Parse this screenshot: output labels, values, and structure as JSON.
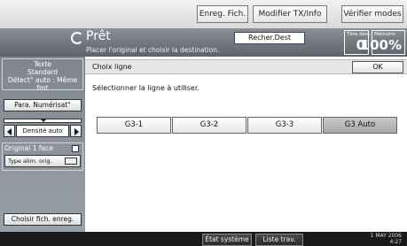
{
  "topbar": {
    "enreg_fich": "Enreg. Fich.",
    "modifier_tx": "Modifier TX/Info",
    "verifier_modes": "Vérifier modes"
  },
  "header": {
    "title": "Prêt",
    "subtitle": "Placer l'original et choisir la destination.",
    "search_button": "Recher.Dest",
    "counter_dest_label": "Titre dest.",
    "counter_dest_value": "0",
    "counter_memory_label": "Mémoire",
    "counter_memory_value": "100%"
  },
  "sidebar": {
    "mode_line1": "Texte",
    "mode_line2": "Standard",
    "mode_line3": "Détect° auto : Même fmt",
    "para_button": "Para. Numérisat°",
    "density_label": "Densité auto",
    "face_label": "Original 1 face",
    "type_button": "Type alim. orig.",
    "choose_file_button": "Choisir fich. enreg."
  },
  "main": {
    "section_label": "Choix ligne",
    "ok_label": "OK",
    "instruction": "Sélectionner la ligne à utiliser.",
    "lines": [
      "G3-1",
      "G3-2",
      "G3-3",
      "G3 Auto"
    ],
    "selected_line": "G3 Auto"
  },
  "bottombar": {
    "system_status": "État système",
    "job_list": "Liste trav.",
    "date_line1": "1 MAY  2006",
    "date_line2": "4:27"
  }
}
